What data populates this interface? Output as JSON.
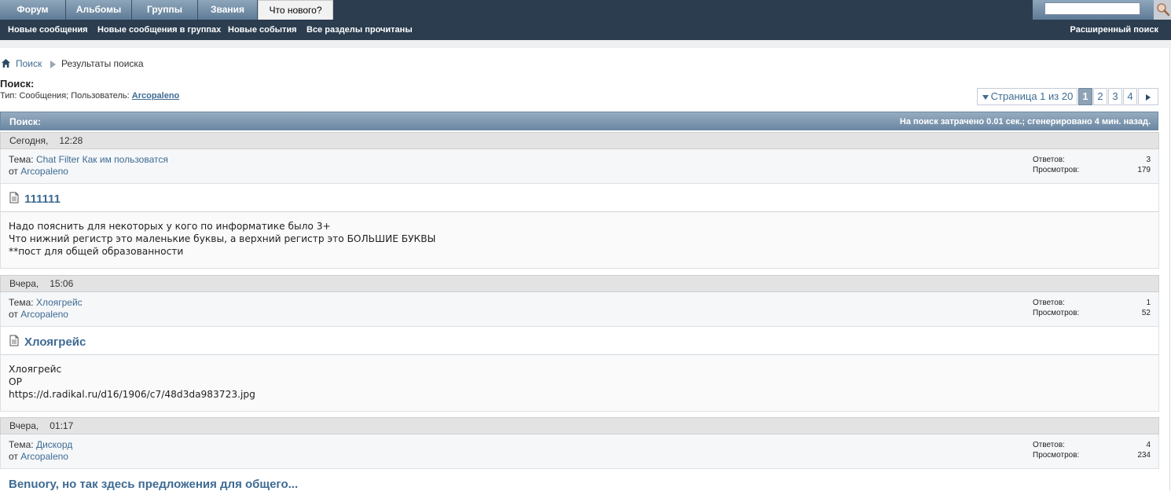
{
  "nav": {
    "tabs": [
      "Форум",
      "Альбомы",
      "Группы",
      "Звания",
      "Что нового?"
    ],
    "subnav": [
      "Новые сообщения",
      "Новые сообщения в группах",
      "Новые события",
      "Все разделы прочитаны"
    ],
    "advanced_search": "Расширенный поиск"
  },
  "breadcrumb": {
    "search": "Поиск",
    "results": "Результаты поиска"
  },
  "page": {
    "title": "Поиск:",
    "meta_prefix": "Тип: Сообщения; Пользователь:",
    "meta_user": "Arcopaleno"
  },
  "pagination": {
    "label": "Страница 1 из 20",
    "pages": [
      "1",
      "2",
      "3",
      "4"
    ],
    "current": "1"
  },
  "results_header": {
    "left": "Поиск:",
    "right": "На поиск затрачено 0.01 сек.; сгенерировано 4 мин. назад."
  },
  "labels": {
    "topic": "Тема:",
    "by": "от",
    "replies": "Ответов:",
    "views": "Просмотров:"
  },
  "results": [
    {
      "date": "Сегодня,",
      "time": "12:28",
      "thread": "Chat Filter Как им пользоватся",
      "author": "Arcopaleno",
      "replies": "3",
      "views": "179",
      "title": "111111",
      "lines": [
        "Надо пояснить для некоторых у кого по информатике было 3+",
        "Что нижний регистр это маленькие буквы, а верхний регистр это БОЛЬШИЕ БУКВЫ",
        "**пост для общей образованности"
      ]
    },
    {
      "date": "Вчера,",
      "time": "15:06",
      "thread": "Хлоягрейс",
      "author": "Arcopaleno",
      "replies": "1",
      "views": "52",
      "title": "Хлоягрейс",
      "lines": [
        "Хлоягрейс",
        "ОР",
        "https://d.radikal.ru/d16/1906/c7/48d3da983723.jpg"
      ]
    },
    {
      "date": "Вчера,",
      "time": "01:17",
      "thread": "Дискорд",
      "author": "Arcopaleno",
      "replies": "4",
      "views": "234",
      "title": "Benuory, но так здесь предложения для общего..."
    }
  ]
}
